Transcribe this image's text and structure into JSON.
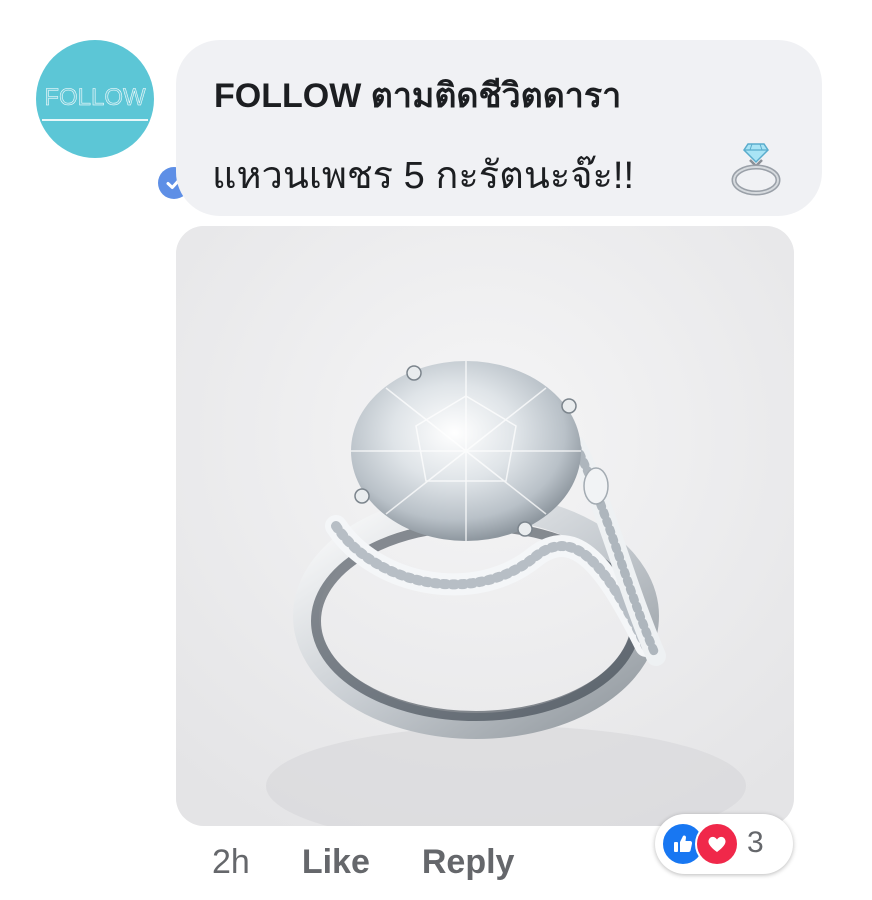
{
  "avatar": {
    "logo_text": "FOLLOW",
    "background": "#5cc6d6",
    "badge_icon": "verified-check-icon",
    "badge_color": "#5e8fe6"
  },
  "comment": {
    "author": "FOLLOW ตามติดชีวิตดารา",
    "text": "แหวนเพชร 5 กะรัตนะจ๊ะ!!",
    "emoji_icon": "ring-icon"
  },
  "photo": {
    "subject_icon": "diamond-ring-photo"
  },
  "actions": {
    "timestamp": "2h",
    "like_label": "Like",
    "reply_label": "Reply"
  },
  "reactions": {
    "icons": [
      "like-reaction-icon",
      "love-reaction-icon"
    ],
    "like_color": "#1877f2",
    "love_color": "#f0284a",
    "count": "3"
  }
}
